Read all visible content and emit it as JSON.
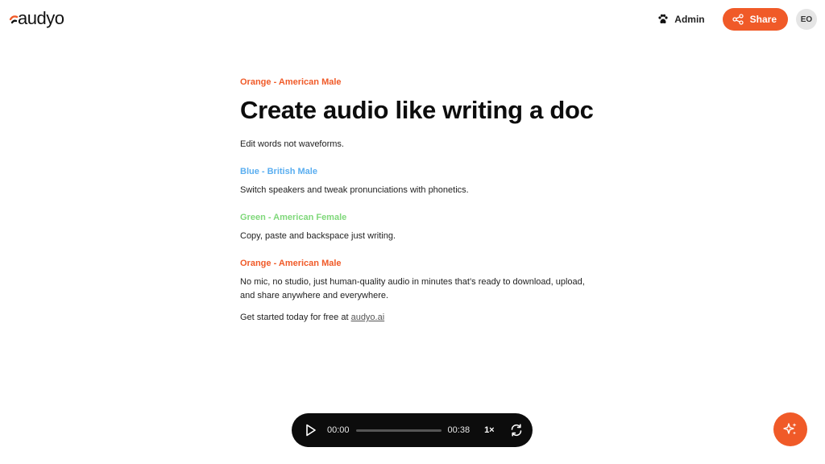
{
  "brand": {
    "logo_text": "audyo",
    "accent": "#f05a28"
  },
  "header": {
    "admin_label": "Admin",
    "admin_icon": "paw-icon",
    "share_label": "Share",
    "share_icon": "share-icon",
    "avatar_initials": "EO"
  },
  "doc": {
    "blocks": [
      {
        "speaker": "Orange - American Male",
        "color": "#f05a28"
      },
      {
        "title": "Create audio like writing a doc"
      },
      {
        "text": "Edit words not waveforms."
      },
      {
        "speaker": "Blue - British Male",
        "color": "#5aaef0",
        "text": "Switch speakers and tweak pronunciations with phonetics."
      },
      {
        "speaker": "Green - American Female",
        "color": "#7fd87a",
        "text": "Copy, paste and backspace just writing."
      },
      {
        "speaker": "Orange - American Male",
        "color": "#f05a28",
        "text": "No mic, no studio, just human-quality audio in minutes that’s ready to download, upload, and share anywhere and everywhere."
      },
      {
        "text_prefix": "Get started today for free at ",
        "link_text": "audyo.ai"
      }
    ]
  },
  "player": {
    "current_time": "00:00",
    "duration": "00:38",
    "speed": "1×",
    "progress": 0,
    "play_icon": "play-icon",
    "repeat_icon": "repeat-icon"
  },
  "fab": {
    "icon": "sparkles-icon"
  }
}
